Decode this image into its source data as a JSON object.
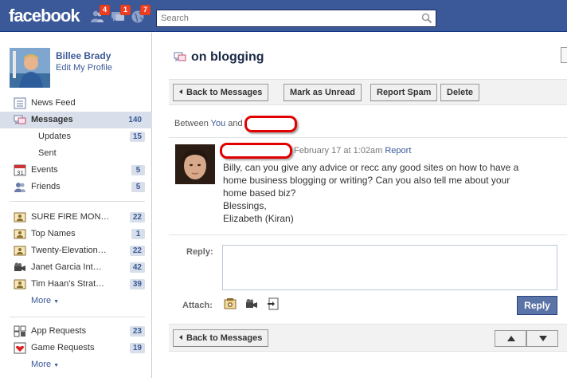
{
  "topbar": {
    "logo": "facebook",
    "jewels": [
      {
        "icon": "friend-requests-icon",
        "count": "4"
      },
      {
        "icon": "messages-icon",
        "count": "1"
      },
      {
        "icon": "notifications-globe-icon",
        "count": "7"
      }
    ],
    "search_placeholder": "Search"
  },
  "profile": {
    "name": "Billee Brady",
    "edit_label": "Edit My Profile"
  },
  "nav_main": [
    {
      "label": "News Feed",
      "icon": "news-feed-icon",
      "count": ""
    },
    {
      "label": "Messages",
      "icon": "messages-icon",
      "count": "140",
      "active": true
    },
    {
      "label": "Updates",
      "icon": "",
      "count": "15",
      "sub": true
    },
    {
      "label": "Sent",
      "icon": "",
      "count": "",
      "sub": true
    },
    {
      "label": "Events",
      "icon": "calendar-icon",
      "count": "5"
    },
    {
      "label": "Friends",
      "icon": "friends-icon",
      "count": "5"
    }
  ],
  "nav_groups": [
    {
      "label": "SURE FIRE MONEY…",
      "icon": "page-icon",
      "count": "22"
    },
    {
      "label": "Top Names",
      "icon": "page-icon",
      "count": "1"
    },
    {
      "label": "Twenty-Elevation…",
      "icon": "page-icon",
      "count": "22"
    },
    {
      "label": "Janet Garcia Int…",
      "icon": "video-camera-icon",
      "count": "42"
    },
    {
      "label": "Tim Haan's Strat…",
      "icon": "page-icon",
      "count": "39"
    }
  ],
  "nav_apps": [
    {
      "label": "App Requests",
      "icon": "app-requests-icon",
      "count": "23"
    },
    {
      "label": "Game Requests",
      "icon": "game-requests-icon",
      "count": "19"
    }
  ],
  "more_label": "More",
  "thread": {
    "title": "on blogging",
    "toolbar": {
      "back": "Back to Messages",
      "mark_unread": "Mark as Unread",
      "report_spam": "Report Spam",
      "delete": "Delete"
    },
    "between_prefix": "Between",
    "between_you": "You",
    "between_and": "and",
    "message": {
      "timestamp": "February 17 at 1:02am",
      "report": "Report",
      "lines": [
        "Billy, can you give any advice or recc any good sites on how to have a",
        "home business blogging or writing? Can you also tell me about your",
        "home based biz?",
        "Blessings,",
        "Elizabeth (Kiran)"
      ]
    },
    "reply_label": "Reply:",
    "attach_label": "Attach:",
    "reply_button": "Reply",
    "bottom_back": "Back to Messages"
  },
  "colors": {
    "brand_blue": "#3b5998",
    "badge_red": "#f03d25",
    "redaction_red": "#e10000"
  }
}
